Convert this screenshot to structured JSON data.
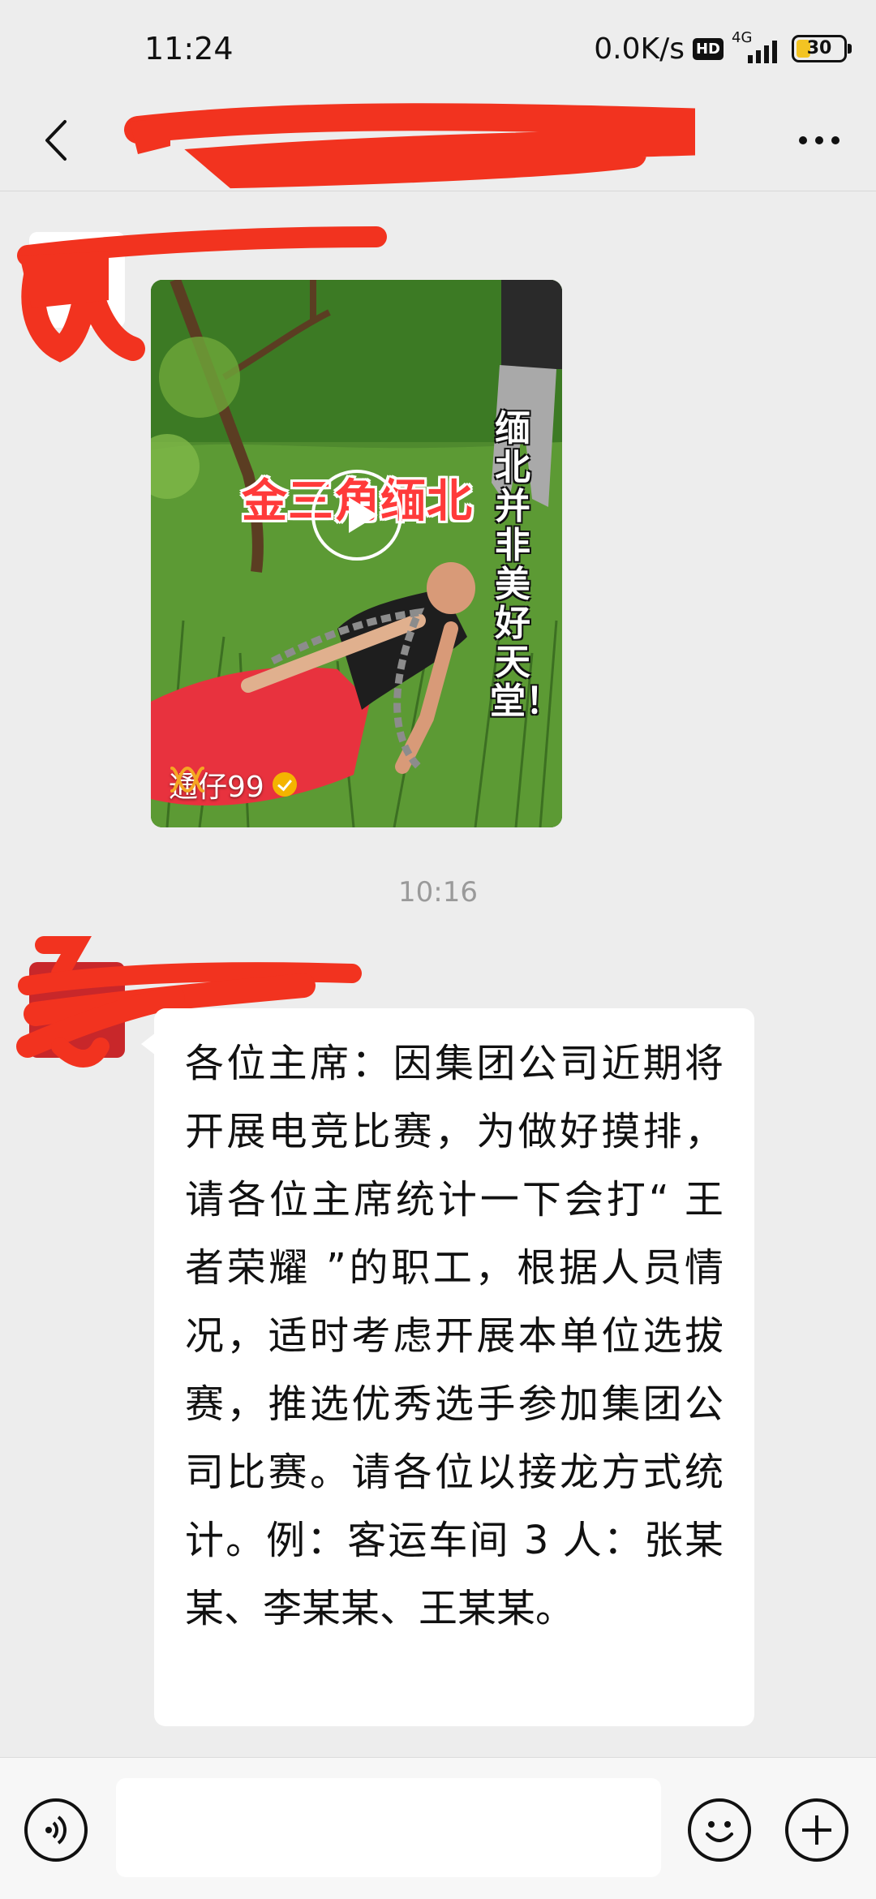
{
  "status_bar": {
    "time": "11:24",
    "network_speed": "0.0K/s",
    "hd_badge": "HD",
    "network_type": "4G",
    "battery_level": "30",
    "battery_fraction": 0.3
  },
  "header": {
    "title": "",
    "back_icon": "chevron-left-icon",
    "more_icon": "more-dots-icon"
  },
  "messages": [
    {
      "type": "video",
      "sender": "",
      "video": {
        "overlay_title": "金三角缅北",
        "overlay_vertical_text": "缅北并非美好天堂！",
        "author": "通仔99",
        "author_verified": true,
        "play_icon": "play-icon"
      }
    },
    {
      "type": "timestamp",
      "text": "10:16"
    },
    {
      "type": "text",
      "sender": "",
      "text": "各位主席：因集团公司近期将开展电竞比赛，为做好摸排，请各位主席统计一下会打“ 王者荣耀 ”的职工，根据人员情况，适时考虑开展本单位选拔赛，推选优秀选手参加集团公司比赛。请各位以接龙方式统计。例：客运车间 3 人：张某某、李某某、王某某。"
    }
  ],
  "input_bar": {
    "input_value": "",
    "voice_icon": "voice-icon",
    "emoji_icon": "emoji-icon",
    "plus_icon": "plus-icon"
  },
  "colors": {
    "background": "#ededed",
    "bubble": "#ffffff",
    "redaction": "#f2331f",
    "verified": "#f4b400"
  }
}
